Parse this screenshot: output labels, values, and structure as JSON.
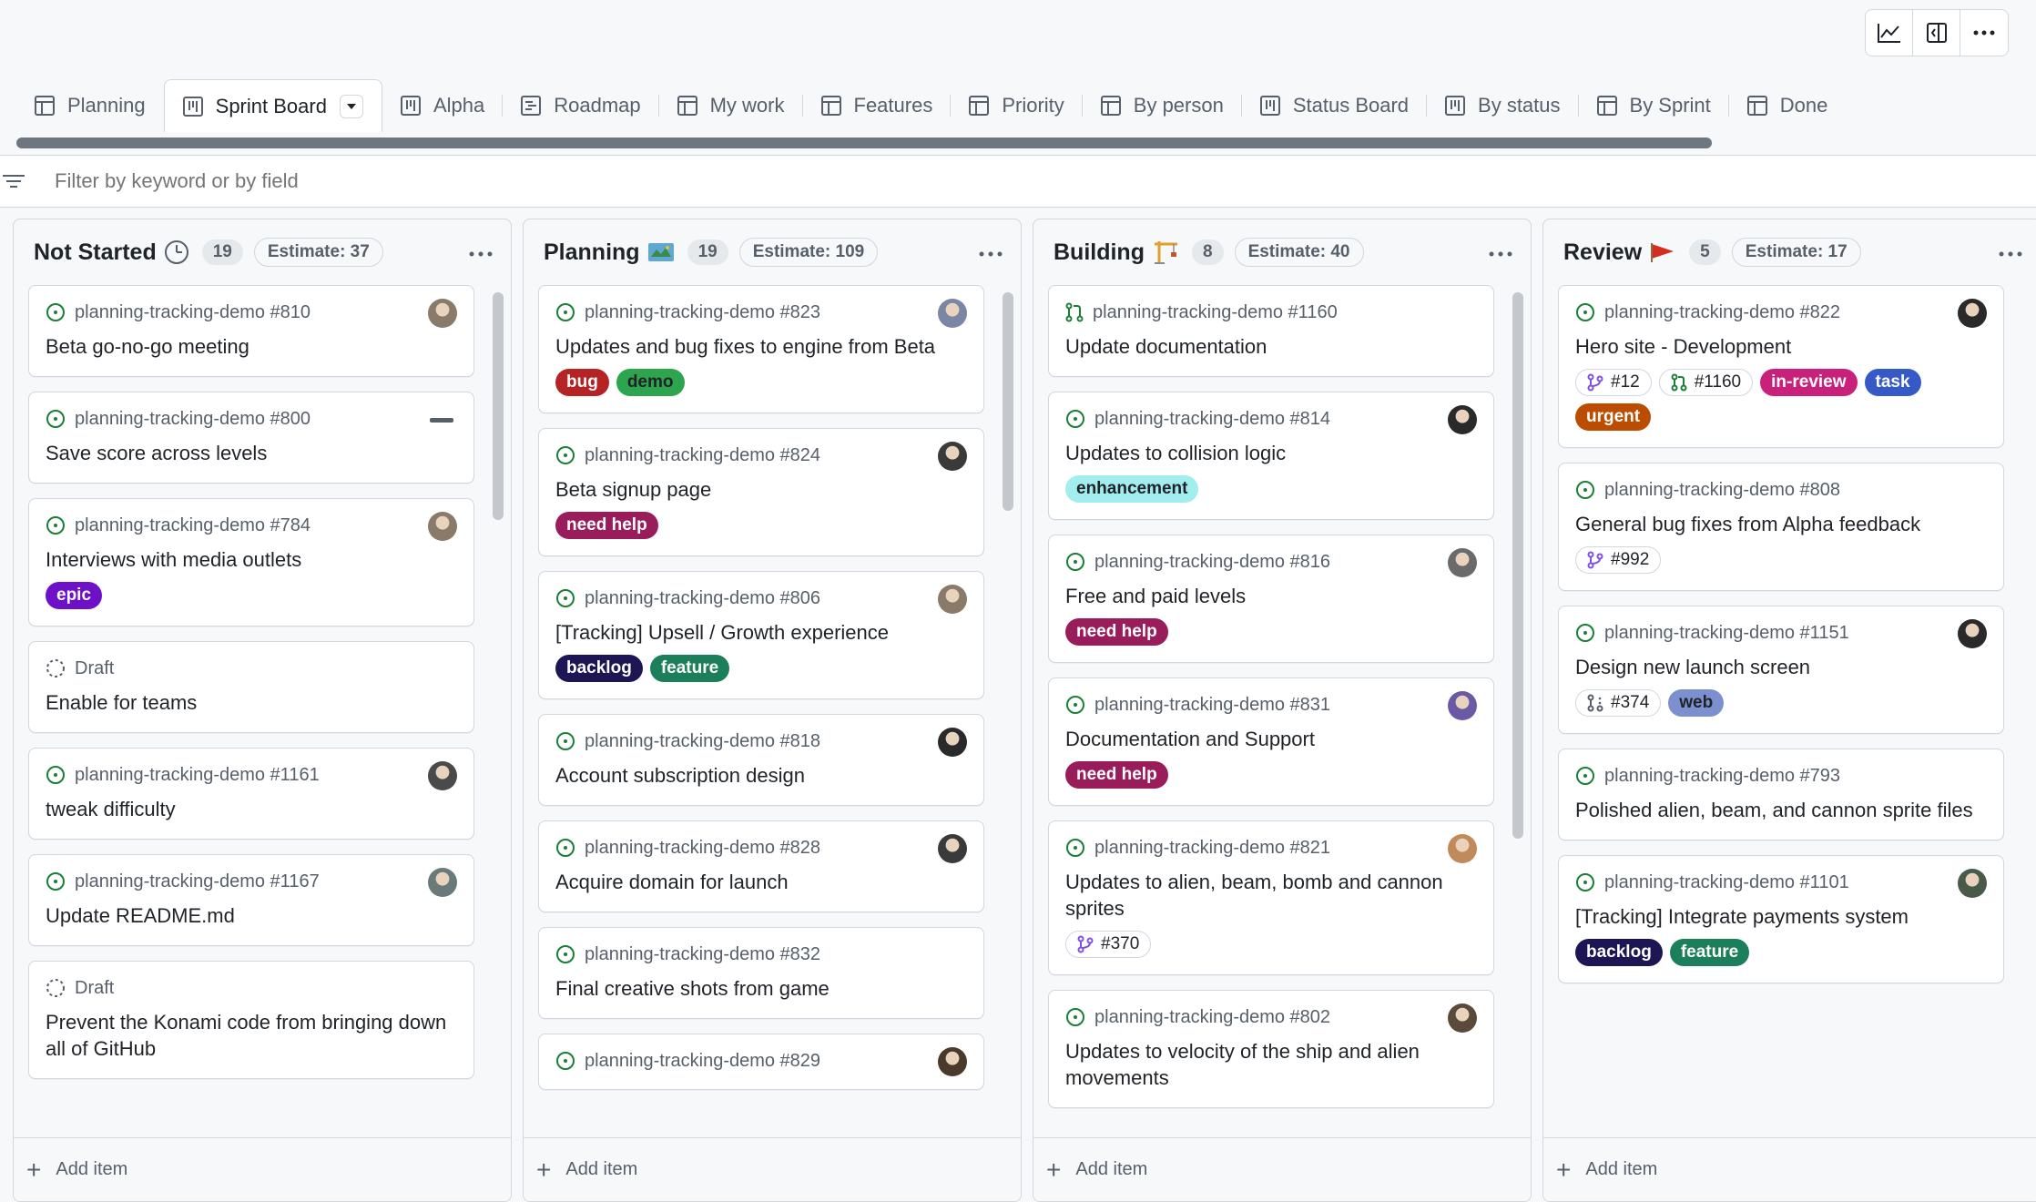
{
  "tabs": [
    {
      "label": "Planning",
      "icon": "table-icon"
    },
    {
      "label": "Sprint Board",
      "icon": "board-icon",
      "active": true
    },
    {
      "label": "Alpha",
      "icon": "board-icon"
    },
    {
      "label": "Roadmap",
      "icon": "roadmap-icon"
    },
    {
      "label": "My work",
      "icon": "table-icon"
    },
    {
      "label": "Features",
      "icon": "table-icon"
    },
    {
      "label": "Priority",
      "icon": "table-icon"
    },
    {
      "label": "By person",
      "icon": "table-icon"
    },
    {
      "label": "Status Board",
      "icon": "board-icon"
    },
    {
      "label": "By status",
      "icon": "board-icon"
    },
    {
      "label": "By Sprint",
      "icon": "table-icon"
    },
    {
      "label": "Done",
      "icon": "table-icon"
    }
  ],
  "filter": {
    "placeholder": "Filter by keyword or by field"
  },
  "add_item_label": "Add item",
  "colors": {
    "bug": "#b62324",
    "demo": "#2da44e",
    "need_help": "#9a1d5b",
    "epic": "#6f10c9",
    "backlog": "#1d1654",
    "feature": "#1a7f5a",
    "enhancement": "#a2eeef",
    "in_review": "#c8207b",
    "task": "#3559c7",
    "urgent": "#bc4c00",
    "web": "#7c8fcf",
    "open_issue": "#1a7f37",
    "draft": "#57606a"
  },
  "columns": [
    {
      "title": "Not Started",
      "emoji": "clock-icon",
      "count": "19",
      "estimate": "Estimate: 37",
      "cards": [
        {
          "repo": "planning-tracking-demo #810",
          "title": "Beta go-no-go meeting",
          "status": "open",
          "avatar": "#8a7a6a"
        },
        {
          "repo": "planning-tracking-demo #800",
          "title": "Save score across levels",
          "status": "open",
          "dash": true
        },
        {
          "repo": "planning-tracking-demo #784",
          "title": "Interviews with media outlets",
          "status": "open",
          "avatar": "#8a7a6a",
          "labels": [
            {
              "text": "epic",
              "color": "#6f10c9"
            }
          ]
        },
        {
          "repo": "Draft",
          "title": "Enable for teams",
          "status": "draft"
        },
        {
          "repo": "planning-tracking-demo #1161",
          "title": "tweak difficulty",
          "status": "open",
          "avatar": "#4a4a4a"
        },
        {
          "repo": "planning-tracking-demo #1167",
          "title": "Update README.md",
          "status": "open",
          "avatar": "#6a7a7a"
        },
        {
          "repo": "Draft",
          "title": "Prevent the Konami code from bringing down all of GitHub",
          "status": "draft"
        }
      ]
    },
    {
      "title": "Planning",
      "emoji": "map-icon",
      "count": "19",
      "estimate": "Estimate: 109",
      "cards": [
        {
          "repo": "planning-tracking-demo #823",
          "title": "Updates and bug fixes to engine from Beta",
          "status": "open",
          "avatar": "#7a86a6",
          "labels": [
            {
              "text": "bug",
              "color": "#b62324"
            },
            {
              "text": "demo",
              "color": "#2da44e",
              "dark": true
            }
          ]
        },
        {
          "repo": "planning-tracking-demo #824",
          "title": "Beta signup page",
          "status": "open",
          "avatar": "#3a3a3a",
          "labels": [
            {
              "text": "need help",
              "color": "#9a1d5b"
            }
          ]
        },
        {
          "repo": "planning-tracking-demo #806",
          "title": "[Tracking] Upsell / Growth experience",
          "status": "open",
          "avatar": "#8a7a6a",
          "labels": [
            {
              "text": "backlog",
              "color": "#1d1654"
            },
            {
              "text": "feature",
              "color": "#1a7f5a"
            }
          ]
        },
        {
          "repo": "planning-tracking-demo #818",
          "title": "Account subscription design",
          "status": "open",
          "avatar": "#2a2a2a"
        },
        {
          "repo": "planning-tracking-demo #828",
          "title": "Acquire domain for launch",
          "status": "open",
          "avatar": "#3a3a3a"
        },
        {
          "repo": "planning-tracking-demo #832",
          "title": "Final creative shots from game",
          "status": "open"
        },
        {
          "repo": "planning-tracking-demo #829",
          "title": "",
          "status": "open",
          "avatar": "#4a3a2a"
        }
      ]
    },
    {
      "title": "Building",
      "emoji": "crane-icon",
      "count": "8",
      "estimate": "Estimate: 40",
      "cards": [
        {
          "repo": "planning-tracking-demo #1160",
          "title": "Update documentation",
          "status": "pr"
        },
        {
          "repo": "planning-tracking-demo #814",
          "title": "Updates to collision logic",
          "status": "open",
          "avatar": "#2a2a2a",
          "labels": [
            {
              "text": "enhancement",
              "color": "#a2eeef",
              "dark": true
            }
          ]
        },
        {
          "repo": "planning-tracking-demo #816",
          "title": "Free and paid levels",
          "status": "open",
          "avatar": "#6a6a6a",
          "labels": [
            {
              "text": "need help",
              "color": "#9a1d5b"
            }
          ]
        },
        {
          "repo": "planning-tracking-demo #831",
          "title": "Documentation and Support",
          "status": "open",
          "avatar": "#6a5aa6",
          "labels": [
            {
              "text": "need help",
              "color": "#9a1d5b"
            }
          ]
        },
        {
          "repo": "planning-tracking-demo #821",
          "title": "Updates to alien, beam, bomb and cannon sprites",
          "status": "open",
          "avatar": "#c08a5a",
          "chips": [
            {
              "text": "#370",
              "icon": "branch-icon"
            }
          ]
        },
        {
          "repo": "planning-tracking-demo #802",
          "title": "Updates to velocity of the ship and alien movements",
          "status": "open",
          "avatar": "#5a4a3a"
        }
      ]
    },
    {
      "title": "Review",
      "emoji": "flag-icon",
      "count": "5",
      "estimate": "Estimate: 17",
      "cards": [
        {
          "repo": "planning-tracking-demo #822",
          "title": "Hero site - Development",
          "status": "open",
          "avatar": "#2a2a2a",
          "chips": [
            {
              "text": "#12",
              "icon": "branch-icon"
            },
            {
              "text": "#1160",
              "icon": "pr-icon"
            }
          ],
          "labels": [
            {
              "text": "in-review",
              "color": "#c8207b"
            },
            {
              "text": "task",
              "color": "#3559c7"
            },
            {
              "text": "urgent",
              "color": "#bc4c00"
            }
          ]
        },
        {
          "repo": "planning-tracking-demo #808",
          "title": "General bug fixes from Alpha feedback",
          "status": "open",
          "chips": [
            {
              "text": "#992",
              "icon": "branch-icon"
            }
          ]
        },
        {
          "repo": "planning-tracking-demo #1151",
          "title": "Design new launch screen",
          "status": "open",
          "avatar": "#2a2a2a",
          "chips": [
            {
              "text": "#374",
              "icon": "pr-draft-icon"
            }
          ],
          "labels": [
            {
              "text": "web",
              "color": "#7c8fcf",
              "dark": true
            }
          ]
        },
        {
          "repo": "planning-tracking-demo #793",
          "title": "Polished alien, beam, and cannon sprite files",
          "status": "open"
        },
        {
          "repo": "planning-tracking-demo #1101",
          "title": "[Tracking] Integrate payments system",
          "status": "open",
          "avatar": "#4a5a4a",
          "labels": [
            {
              "text": "backlog",
              "color": "#1d1654"
            },
            {
              "text": "feature",
              "color": "#1a7f5a"
            }
          ]
        }
      ]
    }
  ]
}
